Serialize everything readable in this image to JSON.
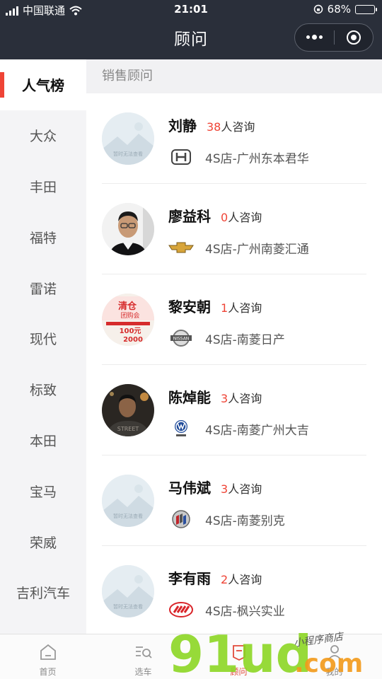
{
  "status_bar": {
    "carrier": "中国联通",
    "time": "21:01",
    "battery_text": "68%",
    "battery_level": 0.68
  },
  "header": {
    "title": "顾问",
    "more_icon": "more-dots-icon",
    "close_icon": "target-icon"
  },
  "sidebar": {
    "items": [
      {
        "label": "人气榜",
        "active": true
      },
      {
        "label": "大众"
      },
      {
        "label": "丰田"
      },
      {
        "label": "福特"
      },
      {
        "label": "雷诺"
      },
      {
        "label": "现代"
      },
      {
        "label": "标致"
      },
      {
        "label": "本田"
      },
      {
        "label": "宝马"
      },
      {
        "label": "荣威"
      },
      {
        "label": "吉利汽车"
      }
    ]
  },
  "main": {
    "section_title": "销售顾问",
    "consultants": [
      {
        "name": "刘静",
        "count": "38",
        "suffix": "人咨询",
        "brand_icon": "honda-logo-icon",
        "store": "4S店-广州东本君华",
        "avatar": "placeholder",
        "placeholder_text": "暂时无法查看"
      },
      {
        "name": "廖益科",
        "count": "0",
        "suffix": "人咨询",
        "brand_icon": "chevrolet-logo-icon",
        "store": "4S店-广州南菱汇通",
        "avatar": "photo-man-glasses"
      },
      {
        "name": "黎安朝",
        "count": "1",
        "suffix": "人咨询",
        "brand_icon": "nissan-logo-icon",
        "store": "4S店-南菱日产",
        "avatar": "promo-poster",
        "promo": {
          "title": "清仓",
          "subtitle": "团购会",
          "discount": "100元",
          "amount": "2000"
        }
      },
      {
        "name": "陈焯能",
        "count": "3",
        "suffix": "人咨询",
        "brand_icon": "volkswagen-logo-icon",
        "store": "4S店-南菱广州大吉",
        "avatar": "photo-man-dark"
      },
      {
        "name": "马伟斌",
        "count": "3",
        "suffix": "人咨询",
        "brand_icon": "buick-logo-icon",
        "store": "4S店-南菱别克",
        "avatar": "placeholder",
        "placeholder_text": "暂时无法查看"
      },
      {
        "name": "李有雨",
        "count": "2",
        "suffix": "人咨询",
        "brand_icon": "lifan-logo-icon",
        "store": "4S店-枫兴实业",
        "avatar": "placeholder",
        "placeholder_text": "暂时无法查看"
      }
    ]
  },
  "tabbar": {
    "tabs": [
      {
        "label": "首页",
        "icon": "home-icon"
      },
      {
        "label": "选车",
        "icon": "car-search-icon"
      },
      {
        "label": "顾问",
        "icon": "advisor-icon",
        "active": true
      },
      {
        "label": "我的",
        "icon": "user-icon"
      }
    ]
  },
  "watermark": {
    "brand": "91ud",
    "domain": ".com",
    "tagline": "小程序商店"
  },
  "colors": {
    "header_bg": "#2a2f3a",
    "accent": "#ef4436",
    "sidebar_bg": "#f4f4f6"
  }
}
